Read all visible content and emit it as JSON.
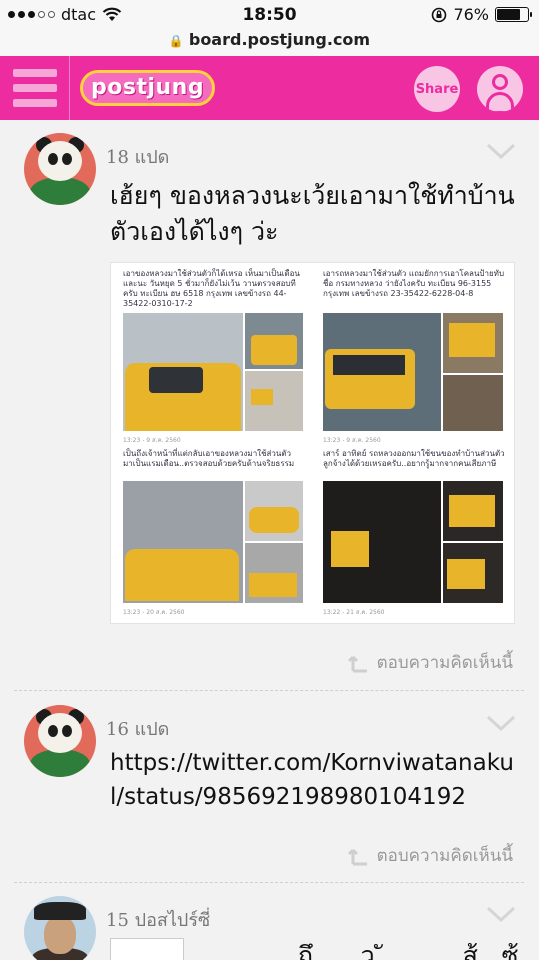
{
  "status_bar": {
    "carrier": "dtac",
    "time": "18:50",
    "battery": "76%",
    "battery_level": 0.76
  },
  "url_bar": {
    "url": "board.postjung.com"
  },
  "header": {
    "logo_text": "postjung",
    "share_label": "Share"
  },
  "posts": [
    {
      "date_num": "18",
      "date_word": "แปด",
      "title": "เฮ้ยๆ ของหลวงนะเว้ยเอามาใช้ทำบ้านตัวเองได้ไงๆ ว่ะ",
      "collage": {
        "captions": [
          "เอาของหลวงมาใช้ส่วนตัวก็ได้เหรอ เห็นมาเป็นเดือนและนะ วันหยุด 5 ชั่วมาก็ยังไม่เว้น วานตรวจสอบทีครับ ทะเบียน ฮษ 6518 กรุงเทพ เลขข้างรถ 44-35422-0310-17-2",
          "เอารถหลวงมาใช้ส่วนตัว แถมยักการเอาโคลนป้ายทับชื่อ กรมทางหลวง ว่ายังไงครับ ทะเบียน 96-3155 กรุงเทพ เลขข้างรถ 23-35422-6228-04-8",
          "เป็นถึงเจ้าหน้าที่แต่กลับเอาของหลวงมาใช้ส่วนตัว มาเป็นแรมเดือน..ตรวจสอบด้วยครับด้านจริยธรรม",
          "เสาร์ อาทิตย์ รถหลวงออกมาใช้ขนของทำบ้านส่วนตัวลูกจ้างได้ด้วยเหรอครับ..อยากรู้มากจากคนเสียภาษี"
        ],
        "footnotes": [
          "13:23 - 9 ส.ค. 2560",
          "13:23 - 9 ส.ค. 2560",
          "13:23 - 20 ส.ค. 2560",
          "13:22 - 21 ส.ค. 2560"
        ]
      },
      "reply_label": "ตอบความคิดเห็นนี้"
    },
    {
      "date_num": "16",
      "date_word": "แปด",
      "link": "https://twitter.com/Kornviwatanakul/status/985692198980104192",
      "reply_label": "ตอบความคิดเห็นนี้"
    },
    {
      "date_num": "15",
      "date_word": "ปอสไปร์ซี่",
      "partial_text": "...ถึ.... .ว ั .... ....ส้ ..ซ้...."
    }
  ],
  "icons": {
    "signal": "signal-dots-icon",
    "wifi": "wifi-icon",
    "lock": "lock-icon",
    "orientation_lock": "orientation-lock-icon",
    "battery": "battery-icon",
    "menu": "hamburger-menu-icon",
    "user": "user-icon",
    "chevron": "chevron-down-icon",
    "reply": "reply-arrow-icon"
  },
  "colors": {
    "brand": "#ec2c9f",
    "brand_light": "#f9c5e5",
    "logo_border": "#ffd23a",
    "text_muted": "#999999"
  }
}
